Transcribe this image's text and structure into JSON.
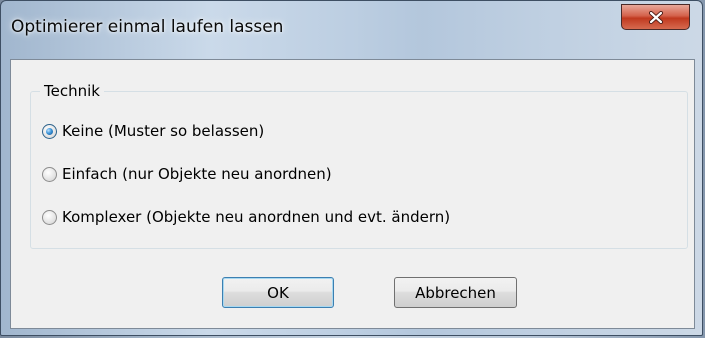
{
  "window": {
    "title": "Optimierer einmal laufen lassen",
    "close_icon": "close-icon"
  },
  "technique_group": {
    "label": "Technik",
    "options": [
      {
        "label": "Keine (Muster so belassen)",
        "checked": true
      },
      {
        "label": "Einfach (nur Objekte neu anordnen)",
        "checked": false
      },
      {
        "label": "Komplexer (Objekte neu anordnen und evt. ändern)",
        "checked": false
      }
    ]
  },
  "buttons": {
    "ok_label": "OK",
    "cancel_label": "Abbrechen"
  },
  "colors": {
    "close_button": "#c7442a",
    "radio_selected": "#2b7fd0",
    "client_background": "#f0f0f0"
  }
}
